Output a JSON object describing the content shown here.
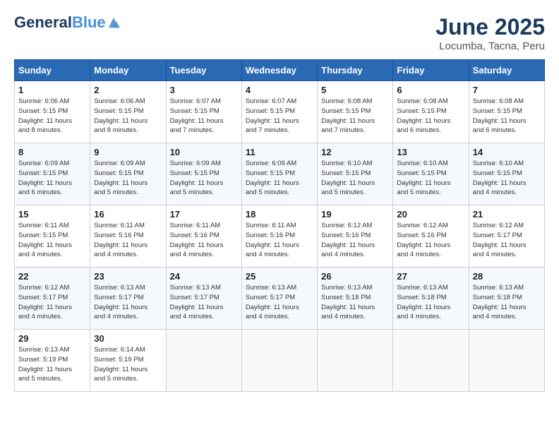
{
  "header": {
    "logo_line1": "General",
    "logo_line2": "Blue",
    "month": "June 2025",
    "location": "Locumba, Tacna, Peru"
  },
  "weekdays": [
    "Sunday",
    "Monday",
    "Tuesday",
    "Wednesday",
    "Thursday",
    "Friday",
    "Saturday"
  ],
  "weeks": [
    [
      {
        "day": "1",
        "sunrise": "6:06 AM",
        "sunset": "5:15 PM",
        "daylight": "11 hours and 8 minutes."
      },
      {
        "day": "2",
        "sunrise": "6:06 AM",
        "sunset": "5:15 PM",
        "daylight": "11 hours and 8 minutes."
      },
      {
        "day": "3",
        "sunrise": "6:07 AM",
        "sunset": "5:15 PM",
        "daylight": "11 hours and 7 minutes."
      },
      {
        "day": "4",
        "sunrise": "6:07 AM",
        "sunset": "5:15 PM",
        "daylight": "11 hours and 7 minutes."
      },
      {
        "day": "5",
        "sunrise": "6:08 AM",
        "sunset": "5:15 PM",
        "daylight": "11 hours and 7 minutes."
      },
      {
        "day": "6",
        "sunrise": "6:08 AM",
        "sunset": "5:15 PM",
        "daylight": "11 hours and 6 minutes."
      },
      {
        "day": "7",
        "sunrise": "6:08 AM",
        "sunset": "5:15 PM",
        "daylight": "11 hours and 6 minutes."
      }
    ],
    [
      {
        "day": "8",
        "sunrise": "6:09 AM",
        "sunset": "5:15 PM",
        "daylight": "11 hours and 6 minutes."
      },
      {
        "day": "9",
        "sunrise": "6:09 AM",
        "sunset": "5:15 PM",
        "daylight": "11 hours and 5 minutes."
      },
      {
        "day": "10",
        "sunrise": "6:09 AM",
        "sunset": "5:15 PM",
        "daylight": "11 hours and 5 minutes."
      },
      {
        "day": "11",
        "sunrise": "6:09 AM",
        "sunset": "5:15 PM",
        "daylight": "11 hours and 5 minutes."
      },
      {
        "day": "12",
        "sunrise": "6:10 AM",
        "sunset": "5:15 PM",
        "daylight": "11 hours and 5 minutes."
      },
      {
        "day": "13",
        "sunrise": "6:10 AM",
        "sunset": "5:15 PM",
        "daylight": "11 hours and 5 minutes."
      },
      {
        "day": "14",
        "sunrise": "6:10 AM",
        "sunset": "5:15 PM",
        "daylight": "11 hours and 4 minutes."
      }
    ],
    [
      {
        "day": "15",
        "sunrise": "6:11 AM",
        "sunset": "5:15 PM",
        "daylight": "11 hours and 4 minutes."
      },
      {
        "day": "16",
        "sunrise": "6:11 AM",
        "sunset": "5:16 PM",
        "daylight": "11 hours and 4 minutes."
      },
      {
        "day": "17",
        "sunrise": "6:11 AM",
        "sunset": "5:16 PM",
        "daylight": "11 hours and 4 minutes."
      },
      {
        "day": "18",
        "sunrise": "6:11 AM",
        "sunset": "5:16 PM",
        "daylight": "11 hours and 4 minutes."
      },
      {
        "day": "19",
        "sunrise": "6:12 AM",
        "sunset": "5:16 PM",
        "daylight": "11 hours and 4 minutes."
      },
      {
        "day": "20",
        "sunrise": "6:12 AM",
        "sunset": "5:16 PM",
        "daylight": "11 hours and 4 minutes."
      },
      {
        "day": "21",
        "sunrise": "6:12 AM",
        "sunset": "5:17 PM",
        "daylight": "11 hours and 4 minutes."
      }
    ],
    [
      {
        "day": "22",
        "sunrise": "6:12 AM",
        "sunset": "5:17 PM",
        "daylight": "11 hours and 4 minutes."
      },
      {
        "day": "23",
        "sunrise": "6:13 AM",
        "sunset": "5:17 PM",
        "daylight": "11 hours and 4 minutes."
      },
      {
        "day": "24",
        "sunrise": "6:13 AM",
        "sunset": "5:17 PM",
        "daylight": "11 hours and 4 minutes."
      },
      {
        "day": "25",
        "sunrise": "6:13 AM",
        "sunset": "5:17 PM",
        "daylight": "11 hours and 4 minutes."
      },
      {
        "day": "26",
        "sunrise": "6:13 AM",
        "sunset": "5:18 PM",
        "daylight": "11 hours and 4 minutes."
      },
      {
        "day": "27",
        "sunrise": "6:13 AM",
        "sunset": "5:18 PM",
        "daylight": "11 hours and 4 minutes."
      },
      {
        "day": "28",
        "sunrise": "6:13 AM",
        "sunset": "5:18 PM",
        "daylight": "11 hours and 4 minutes."
      }
    ],
    [
      {
        "day": "29",
        "sunrise": "6:13 AM",
        "sunset": "5:19 PM",
        "daylight": "11 hours and 5 minutes."
      },
      {
        "day": "30",
        "sunrise": "6:14 AM",
        "sunset": "5:19 PM",
        "daylight": "11 hours and 5 minutes."
      },
      null,
      null,
      null,
      null,
      null
    ]
  ]
}
